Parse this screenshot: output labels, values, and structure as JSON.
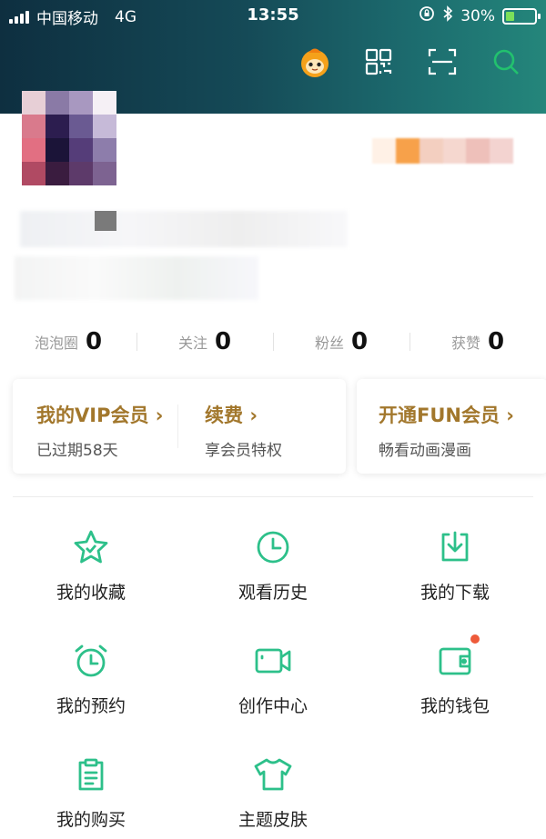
{
  "status_bar": {
    "carrier": "中国移动",
    "network": "4G",
    "time": "13:55",
    "battery_percent": "30%",
    "battery_level": 0.3
  },
  "header": {
    "icons": [
      "mascot-avatar-icon",
      "qr-code-icon",
      "scan-icon",
      "search-icon"
    ],
    "accent_color": "#22c16e"
  },
  "stats": [
    {
      "label": "泡泡圈",
      "value": "0"
    },
    {
      "label": "关注",
      "value": "0"
    },
    {
      "label": "粉丝",
      "value": "0"
    },
    {
      "label": "获赞",
      "value": "0"
    }
  ],
  "vip": {
    "my_vip": {
      "title": "我的VIP会员",
      "arrow": "›",
      "sub": "已过期58天"
    },
    "renew": {
      "title": "续费",
      "arrow": "›",
      "sub": "享会员特权"
    },
    "fun": {
      "title": "开通FUN会员",
      "arrow": "›",
      "sub": "畅看动画漫画"
    },
    "title_color": "#a2772c"
  },
  "menu": {
    "items": [
      {
        "label": "我的收藏",
        "icon": "star-icon"
      },
      {
        "label": "观看历史",
        "icon": "clock-icon"
      },
      {
        "label": "我的下载",
        "icon": "download-icon"
      },
      {
        "label": "我的预约",
        "icon": "alarm-clock-icon"
      },
      {
        "label": "创作中心",
        "icon": "video-camera-icon"
      },
      {
        "label": "我的钱包",
        "icon": "wallet-icon"
      },
      {
        "label": "我的购买",
        "icon": "clipboard-icon"
      },
      {
        "label": "主题皮肤",
        "icon": "t-shirt-icon"
      }
    ],
    "icon_color": "#2dc08a",
    "badge_color": "#ee5a3a"
  }
}
